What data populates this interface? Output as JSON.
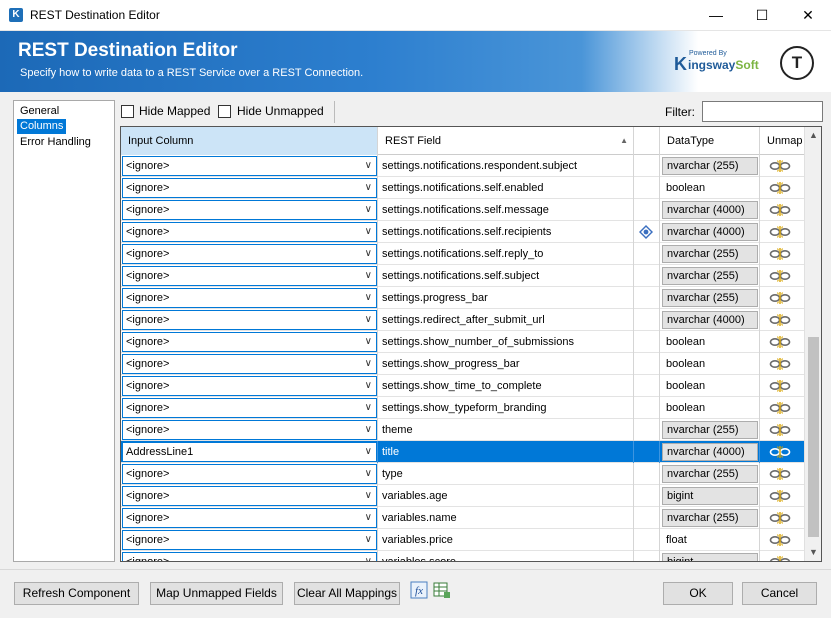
{
  "window": {
    "title": "REST Destination Editor",
    "app_icon": "K",
    "controls": {
      "minimize": "—",
      "maximize": "☐",
      "close": "✕"
    }
  },
  "header": {
    "title": "REST Destination Editor",
    "subtitle": "Specify how to write data to a REST Service over a REST Connection.",
    "logo": {
      "powered_by": "Powered By",
      "k": "K",
      "word_a": "ingsway",
      "word_b": "Soft"
    },
    "avatar": "T"
  },
  "nav": {
    "items": [
      {
        "label": "General",
        "selected": false
      },
      {
        "label": "Columns",
        "selected": true
      },
      {
        "label": "Error Handling",
        "selected": false
      }
    ]
  },
  "toolbar": {
    "hide_mapped": "Hide Mapped",
    "hide_unmapped": "Hide Unmapped",
    "filter_label": "Filter:",
    "filter_value": ""
  },
  "grid": {
    "columns": {
      "input": "Input Column",
      "field": "REST Field",
      "flag": "",
      "datatype": "DataType",
      "unmap": "Unmap"
    },
    "rows": [
      {
        "input": "<ignore>",
        "field": "settings.notifications.respondent.subject",
        "flag": false,
        "datatype": "nvarchar (255)",
        "dt_box": true,
        "selected": false
      },
      {
        "input": "<ignore>",
        "field": "settings.notifications.self.enabled",
        "flag": false,
        "datatype": "boolean",
        "dt_box": false,
        "selected": false
      },
      {
        "input": "<ignore>",
        "field": "settings.notifications.self.message",
        "flag": false,
        "datatype": "nvarchar (4000)",
        "dt_box": true,
        "selected": false
      },
      {
        "input": "<ignore>",
        "field": "settings.notifications.self.recipients",
        "flag": true,
        "datatype": "nvarchar (4000)",
        "dt_box": true,
        "selected": false
      },
      {
        "input": "<ignore>",
        "field": "settings.notifications.self.reply_to",
        "flag": false,
        "datatype": "nvarchar (255)",
        "dt_box": true,
        "selected": false
      },
      {
        "input": "<ignore>",
        "field": "settings.notifications.self.subject",
        "flag": false,
        "datatype": "nvarchar (255)",
        "dt_box": true,
        "selected": false
      },
      {
        "input": "<ignore>",
        "field": "settings.progress_bar",
        "flag": false,
        "datatype": "nvarchar (255)",
        "dt_box": true,
        "selected": false
      },
      {
        "input": "<ignore>",
        "field": "settings.redirect_after_submit_url",
        "flag": false,
        "datatype": "nvarchar (4000)",
        "dt_box": true,
        "selected": false
      },
      {
        "input": "<ignore>",
        "field": "settings.show_number_of_submissions",
        "flag": false,
        "datatype": "boolean",
        "dt_box": false,
        "selected": false
      },
      {
        "input": "<ignore>",
        "field": "settings.show_progress_bar",
        "flag": false,
        "datatype": "boolean",
        "dt_box": false,
        "selected": false
      },
      {
        "input": "<ignore>",
        "field": "settings.show_time_to_complete",
        "flag": false,
        "datatype": "boolean",
        "dt_box": false,
        "selected": false
      },
      {
        "input": "<ignore>",
        "field": "settings.show_typeform_branding",
        "flag": false,
        "datatype": "boolean",
        "dt_box": false,
        "selected": false
      },
      {
        "input": "<ignore>",
        "field": "theme",
        "flag": false,
        "datatype": "nvarchar (255)",
        "dt_box": true,
        "selected": false
      },
      {
        "input": "AddressLine1",
        "field": "title",
        "flag": false,
        "datatype": "nvarchar (4000)",
        "dt_box": true,
        "selected": true
      },
      {
        "input": "<ignore>",
        "field": "type",
        "flag": false,
        "datatype": "nvarchar (255)",
        "dt_box": true,
        "selected": false
      },
      {
        "input": "<ignore>",
        "field": "variables.age",
        "flag": false,
        "datatype": "bigint",
        "dt_box": true,
        "selected": false
      },
      {
        "input": "<ignore>",
        "field": "variables.name",
        "flag": false,
        "datatype": "nvarchar (255)",
        "dt_box": true,
        "selected": false
      },
      {
        "input": "<ignore>",
        "field": "variables.price",
        "flag": false,
        "datatype": "float",
        "dt_box": false,
        "selected": false
      },
      {
        "input": "<ignore>",
        "field": "variables.score",
        "flag": false,
        "datatype": "bigint",
        "dt_box": true,
        "selected": false
      }
    ]
  },
  "buttons": {
    "refresh": "Refresh Component",
    "map_unmapped": "Map Unmapped Fields",
    "clear_all": "Clear All Mappings",
    "ok": "OK",
    "cancel": "Cancel"
  },
  "icons": {
    "expression": "fx-icon",
    "grid_export": "grid-export-icon"
  },
  "colors": {
    "accent": "#0078d7",
    "header_blue": "#1c69b7",
    "input_header": "#cce4f7"
  }
}
